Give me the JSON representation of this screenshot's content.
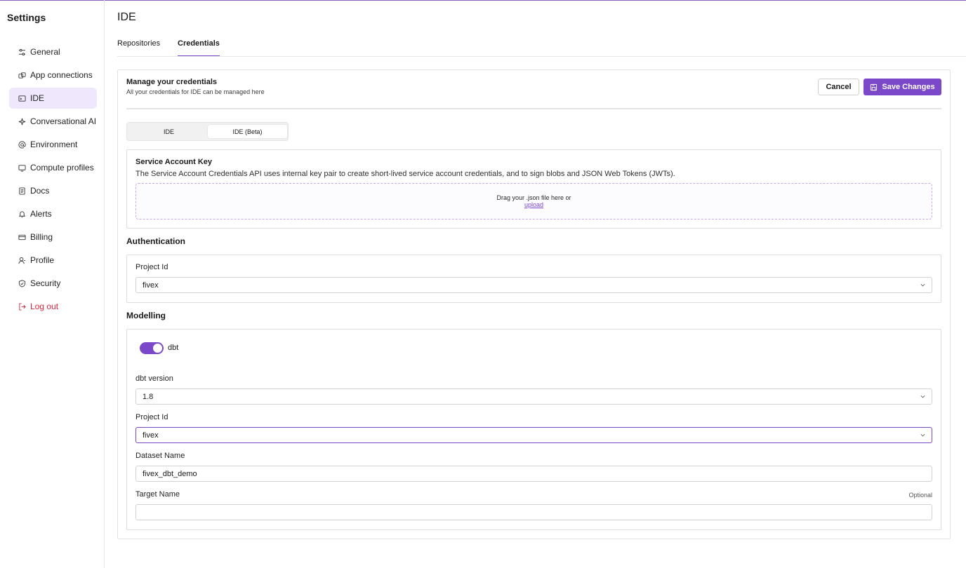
{
  "sidebar": {
    "title": "Settings",
    "items": [
      {
        "label": "General",
        "icon": "sliders-icon"
      },
      {
        "label": "App connections",
        "icon": "link-icon"
      },
      {
        "label": "IDE",
        "icon": "terminal-icon",
        "active": true
      },
      {
        "label": "Conversational AI",
        "icon": "sparkle-icon"
      },
      {
        "label": "Environment",
        "icon": "at-icon"
      },
      {
        "label": "Compute profiles",
        "icon": "monitor-icon"
      },
      {
        "label": "Docs",
        "icon": "document-icon"
      },
      {
        "label": "Alerts",
        "icon": "bell-icon"
      },
      {
        "label": "Billing",
        "icon": "card-icon"
      },
      {
        "label": "Profile",
        "icon": "user-icon"
      },
      {
        "label": "Security",
        "icon": "shield-icon"
      },
      {
        "label": "Log out",
        "icon": "logout-icon"
      }
    ]
  },
  "header": {
    "title": "IDE",
    "tabs": [
      {
        "label": "Repositories"
      },
      {
        "label": "Credentials",
        "active": true
      }
    ]
  },
  "card": {
    "title": "Manage your credentials",
    "subtitle": "All your credentials for IDE can be managed here",
    "cancel_label": "Cancel",
    "save_label": "Save Changes",
    "segments": [
      {
        "label": "IDE"
      },
      {
        "label": "IDE (Beta)",
        "selected": true
      }
    ],
    "service_account": {
      "title": "Service Account Key",
      "description": "The Service Account Credentials API uses internal key pair to create short-lived service account credentials, and to sign blobs and JSON Web Tokens (JWTs).",
      "drop_text": "Drag your .json file here or",
      "upload_link": "upload"
    },
    "authentication": {
      "title": "Authentication",
      "project_id_label": "Project Id",
      "project_id_value": "fivex"
    },
    "modelling": {
      "title": "Modelling",
      "toggle_label": "dbt",
      "toggle_on": true,
      "dbt_version_label": "dbt version",
      "dbt_version_value": "1.8",
      "project_id_label": "Project Id",
      "project_id_value": "fivex",
      "dataset_name_label": "Dataset Name",
      "dataset_name_value": "fivex_dbt_demo",
      "target_name_label": "Target Name",
      "target_name_optional": "Optional",
      "target_name_value": ""
    }
  },
  "colors": {
    "accent": "#7b48c9",
    "active_nav_bg": "#efe7fb",
    "logout": "#d6263e"
  }
}
